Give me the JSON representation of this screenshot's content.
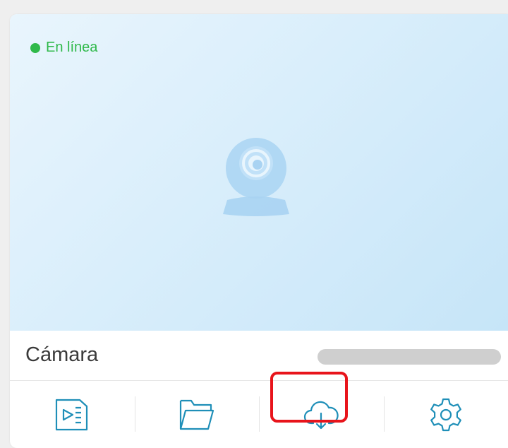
{
  "status": {
    "label": "En línea",
    "color": "#2fb94a"
  },
  "device": {
    "name": "Cámara"
  },
  "toolbar": {
    "items": [
      {
        "icon": "video-playback-icon"
      },
      {
        "icon": "folder-icon"
      },
      {
        "icon": "cloud-download-icon",
        "highlighted": true
      },
      {
        "icon": "gear-icon"
      }
    ],
    "icon_color": "#1f8fb8",
    "highlight_color": "#e8141b"
  },
  "preview": {
    "placeholder_icon": "camera-icon"
  }
}
